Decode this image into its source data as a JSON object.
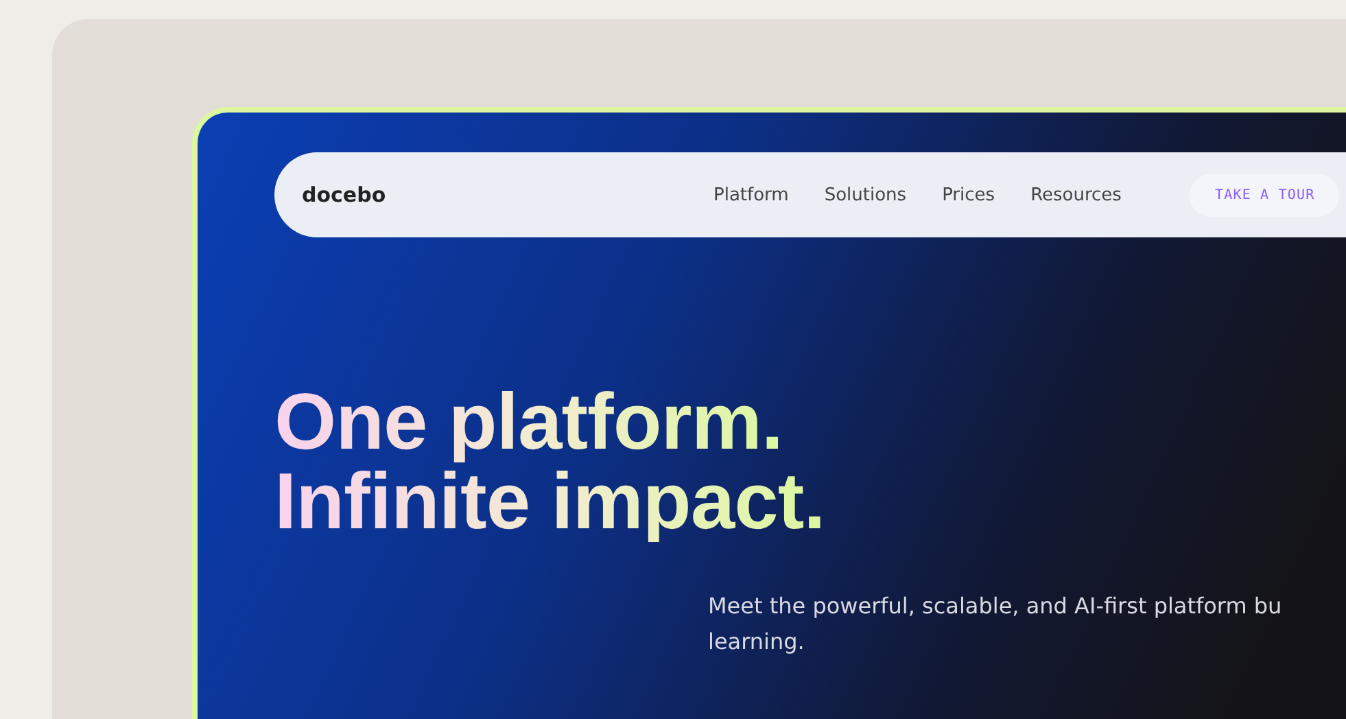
{
  "nav": {
    "logo": "docebo",
    "links": [
      "Platform",
      "Solutions",
      "Prices",
      "Resources"
    ],
    "cta": "TAKE A TOUR"
  },
  "hero": {
    "headline": [
      "One platform.",
      "Infinite impact."
    ],
    "intro": [
      "Meet the powerful, scalable, and AI-first platform bu",
      "learning."
    ]
  }
}
